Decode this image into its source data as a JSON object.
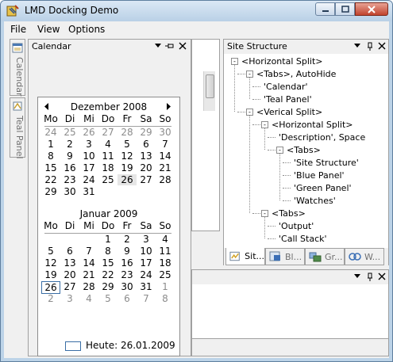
{
  "window": {
    "title": "LMD Docking Demo",
    "colors": {
      "accent": "#3a6ea5",
      "frame": "#bcd3e8",
      "close": "#c1432d"
    }
  },
  "menu": [
    "File",
    "View",
    "Options"
  ],
  "side_tabs": [
    {
      "label": "Calendar",
      "icon": "calendar-icon"
    },
    {
      "label": "Teal Panel",
      "icon": "teal-panel-icon"
    }
  ],
  "calendar_panel": {
    "title": "Calendar",
    "months": [
      {
        "title": "Dezember 2008",
        "weekdays": [
          "Mo",
          "Di",
          "Mi",
          "Do",
          "Fr",
          "Sa",
          "So"
        ],
        "weeks": [
          [
            "24",
            "25",
            "26",
            "27",
            "28",
            "29",
            "30"
          ],
          [
            "1",
            "2",
            "3",
            "4",
            "5",
            "6",
            "7"
          ],
          [
            "8",
            "9",
            "10",
            "11",
            "12",
            "13",
            "14"
          ],
          [
            "15",
            "16",
            "17",
            "18",
            "19",
            "20",
            "21"
          ],
          [
            "22",
            "23",
            "24",
            "25",
            "26",
            "27",
            "28"
          ],
          [
            "29",
            "30",
            "31",
            "",
            "",
            "",
            ""
          ]
        ]
      },
      {
        "title": "Januar 2009",
        "weekdays": [
          "Mo",
          "Di",
          "Mi",
          "Do",
          "Fr",
          "Sa",
          "So"
        ],
        "weeks": [
          [
            "",
            "",
            "",
            "1",
            "2",
            "3",
            "4"
          ],
          [
            "5",
            "6",
            "7",
            "8",
            "9",
            "10",
            "11"
          ],
          [
            "12",
            "13",
            "14",
            "15",
            "16",
            "17",
            "18"
          ],
          [
            "19",
            "20",
            "21",
            "22",
            "23",
            "24",
            "25"
          ],
          [
            "26",
            "27",
            "28",
            "29",
            "30",
            "31",
            "1"
          ],
          [
            "2",
            "3",
            "4",
            "5",
            "6",
            "7",
            "8"
          ]
        ]
      }
    ],
    "today_label": "Heute: 26.01.2009"
  },
  "site_structure_panel": {
    "title": "Site Structure",
    "tree": [
      {
        "label": "<Horizontal Split>",
        "level": 0,
        "expander": "-"
      },
      {
        "label": "<Tabs>, AutoHide",
        "level": 1,
        "expander": "-"
      },
      {
        "label": "'Calendar'",
        "level": 2,
        "expander": ""
      },
      {
        "label": "'Teal Panel'",
        "level": 2,
        "expander": ""
      },
      {
        "label": "<Verical Split>",
        "level": 1,
        "expander": "-"
      },
      {
        "label": "<Horizontal Split>",
        "level": 2,
        "expander": "-"
      },
      {
        "label": "'Description', Space",
        "level": 3,
        "expander": ""
      },
      {
        "label": "<Tabs>",
        "level": 3,
        "expander": "-"
      },
      {
        "label": "'Site Structure'",
        "level": 4,
        "expander": ""
      },
      {
        "label": "'Blue Panel'",
        "level": 4,
        "expander": ""
      },
      {
        "label": "'Green Panel'",
        "level": 4,
        "expander": ""
      },
      {
        "label": "'Watches'",
        "level": 4,
        "expander": ""
      },
      {
        "label": "<Tabs>",
        "level": 2,
        "expander": "-"
      },
      {
        "label": "'Output'",
        "level": 3,
        "expander": ""
      },
      {
        "label": "'Call Stack'",
        "level": 3,
        "expander": ""
      }
    ],
    "bottom_tabs": [
      {
        "label": "Sit...",
        "icon": "site-structure-icon",
        "active": true
      },
      {
        "label": "Bl...",
        "icon": "blue-panel-icon",
        "active": false
      },
      {
        "label": "Gr...",
        "icon": "green-panel-icon",
        "active": false
      },
      {
        "label": "W...",
        "icon": "watches-icon",
        "active": false
      }
    ]
  }
}
